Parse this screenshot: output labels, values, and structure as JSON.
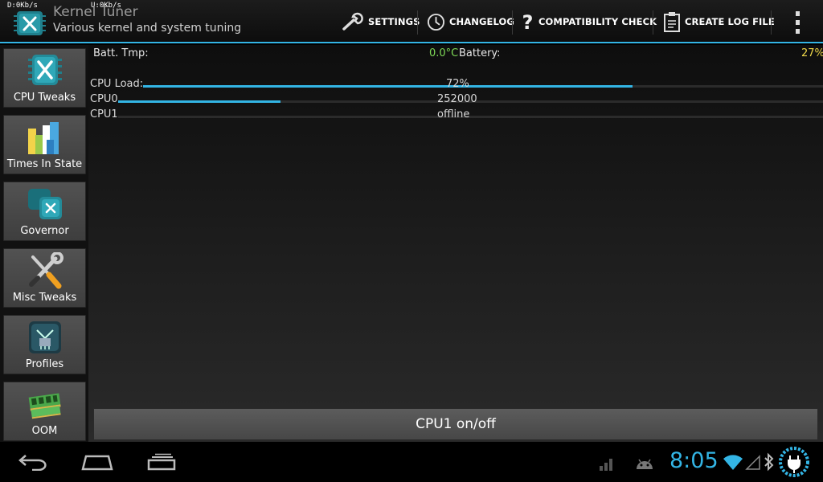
{
  "status": {
    "down_speed": "D:0Kb/s",
    "up_speed": "U:0Kb/s"
  },
  "app": {
    "title": "Kernel Tuner",
    "subtitle": "Various kernel and system tuning",
    "icon": "cpu-chip-icon"
  },
  "actions": [
    {
      "label": "SETTINGS",
      "icon": "wrench-icon"
    },
    {
      "label": "CHANGELOG",
      "icon": "clock-icon"
    },
    {
      "label": "COMPATIBILITY CHECK",
      "icon": "question-icon"
    },
    {
      "label": "CREATE LOG FILE",
      "icon": "clipboard-icon"
    }
  ],
  "sidebar": {
    "items": [
      {
        "label": "CPU Tweaks",
        "icon": "cpu-tweaks-icon"
      },
      {
        "label": "Times In State",
        "icon": "bar-chart-icon"
      },
      {
        "label": "Governor",
        "icon": "governor-icon"
      },
      {
        "label": "Misc Tweaks",
        "icon": "tools-icon"
      },
      {
        "label": "Profiles",
        "icon": "profiles-icon"
      },
      {
        "label": "OOM",
        "icon": "memory-icon"
      }
    ]
  },
  "main": {
    "battery_temp": {
      "label": "Batt. Tmp:",
      "value": "0.0°C"
    },
    "battery": {
      "label": "Battery:",
      "value": "27%"
    },
    "cpu_load": {
      "label": "CPU Load:",
      "value": "72%",
      "fraction": 0.72
    },
    "cpu0": {
      "label": "CPU0",
      "value": "252000",
      "fraction": 0.23
    },
    "cpu1": {
      "label": "CPU1",
      "value": "offline",
      "fraction": 0
    },
    "toggle_button": "CPU1 on/off"
  },
  "systembar": {
    "clock": "8:05",
    "icons": [
      "back-icon",
      "home-icon",
      "recent-apps-icon",
      "signal-icon",
      "android-icon",
      "wifi-icon",
      "cell-signal-icon",
      "bluetooth-icon",
      "battery-charging-icon"
    ]
  },
  "colors": {
    "accent": "#33b5e5",
    "temp": "#7ed957",
    "battery": "#f0d94a"
  }
}
